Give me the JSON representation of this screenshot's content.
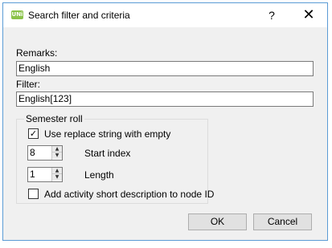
{
  "window": {
    "title": "Search filter and criteria",
    "icon": "app-logo-icon",
    "icon_text": "UNi"
  },
  "titlebar": {
    "help_label": "?",
    "close_label": "✕"
  },
  "remarks": {
    "label": "Remarks:",
    "value": "English"
  },
  "filter": {
    "label": "Filter:",
    "value": "English[123]"
  },
  "semester": {
    "group_label": "Semester roll",
    "replace_checkbox": {
      "label": "Use replace string with empty",
      "checked": true,
      "mark": "✓"
    },
    "start_index": {
      "label": "Start index",
      "value": "8"
    },
    "length": {
      "label": "Length",
      "value": "1"
    },
    "activity_checkbox": {
      "label": "Add activity short description to node ID",
      "checked": false,
      "mark": ""
    }
  },
  "spin": {
    "up": "▲",
    "down": "▼"
  },
  "buttons": {
    "ok": "OK",
    "cancel": "Cancel"
  },
  "colors": {
    "window_border": "#5b9bd5",
    "icon": "#8bc34a",
    "dialog_bg": "#f0f0f0"
  }
}
